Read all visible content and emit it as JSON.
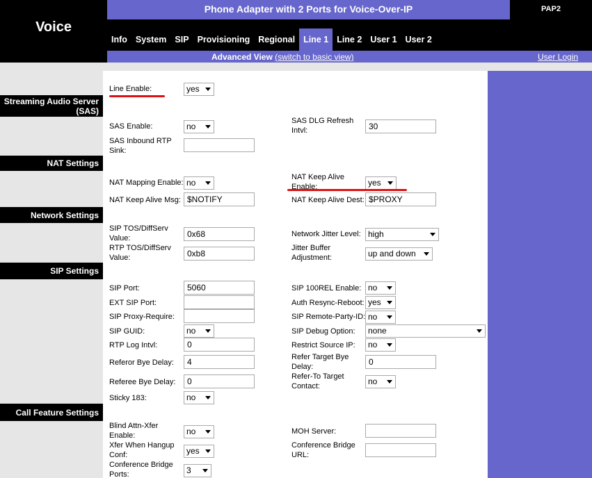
{
  "header": {
    "brand": "Voice",
    "title": "Phone Adapter with 2 Ports for Voice-Over-IP",
    "model": "PAP2"
  },
  "tabs": [
    {
      "label": "Info"
    },
    {
      "label": "System"
    },
    {
      "label": "SIP"
    },
    {
      "label": "Provisioning"
    },
    {
      "label": "Regional"
    },
    {
      "label": "Line 1",
      "active": true
    },
    {
      "label": "Line 2"
    },
    {
      "label": "User 1"
    },
    {
      "label": "User 2"
    }
  ],
  "subbar": {
    "view": "Advanced View",
    "switch_link": "(switch to basic view)",
    "login": "User Login"
  },
  "sections": {
    "sas": "Streaming Audio Server (SAS)",
    "nat": "NAT Settings",
    "network": "Network Settings",
    "sip": "SIP Settings",
    "call_feature": "Call Feature Settings"
  },
  "fields": {
    "line_enable": {
      "label": "Line Enable:",
      "value": "yes"
    },
    "sas_enable": {
      "label": "SAS Enable:",
      "value": "no"
    },
    "sas_dlg_refresh": {
      "label": "SAS DLG Refresh Intvl:",
      "value": "30"
    },
    "sas_inbound_rtp": {
      "label": "SAS Inbound RTP Sink:",
      "value": ""
    },
    "nat_mapping": {
      "label": "NAT Mapping Enable:",
      "value": "no"
    },
    "nat_keep_alive_enable": {
      "label": "NAT Keep Alive Enable:",
      "value": "yes"
    },
    "nat_keep_alive_msg": {
      "label": "NAT Keep Alive Msg:",
      "value": "$NOTIFY"
    },
    "nat_keep_alive_dest": {
      "label": "NAT Keep Alive Dest:",
      "value": "$PROXY"
    },
    "sip_tos": {
      "label": "SIP TOS/DiffServ Value:",
      "value": "0x68"
    },
    "network_jitter": {
      "label": "Network Jitter Level:",
      "value": "high"
    },
    "rtp_tos": {
      "label": "RTP TOS/DiffServ Value:",
      "value": "0xb8"
    },
    "jitter_buffer": {
      "label": "Jitter Buffer Adjustment:",
      "value": "up and down"
    },
    "sip_port": {
      "label": "SIP Port:",
      "value": "5060"
    },
    "sip_100rel": {
      "label": "SIP 100REL Enable:",
      "value": "no"
    },
    "ext_sip_port": {
      "label": "EXT SIP Port:",
      "value": ""
    },
    "auth_resync": {
      "label": "Auth Resync-Reboot:",
      "value": "yes"
    },
    "sip_proxy_require": {
      "label": "SIP Proxy-Require:",
      "value": ""
    },
    "sip_remote_party_id": {
      "label": "SIP Remote-Party-ID:",
      "value": "no"
    },
    "sip_guid": {
      "label": "SIP GUID:",
      "value": "no"
    },
    "sip_debug": {
      "label": "SIP Debug Option:",
      "value": "none"
    },
    "rtp_log": {
      "label": "RTP Log Intvl:",
      "value": "0"
    },
    "restrict_source_ip": {
      "label": "Restrict Source IP:",
      "value": "no"
    },
    "referor_bye": {
      "label": "Referor Bye Delay:",
      "value": "4"
    },
    "refer_target_bye": {
      "label": "Refer Target Bye Delay:",
      "value": "0"
    },
    "referee_bye": {
      "label": "Referee Bye Delay:",
      "value": "0"
    },
    "refer_to_target": {
      "label": "Refer-To Target Contact:",
      "value": "no"
    },
    "sticky_183": {
      "label": "Sticky 183:",
      "value": "no"
    },
    "blind_attn_xfer": {
      "label": "Blind Attn-Xfer Enable:",
      "value": "no"
    },
    "moh_server": {
      "label": "MOH Server:",
      "value": ""
    },
    "xfer_hangup": {
      "label": "Xfer When Hangup Conf:",
      "value": "yes"
    },
    "conf_bridge_url": {
      "label": "Conference Bridge URL:",
      "value": ""
    },
    "conf_bridge_ports": {
      "label": "Conference Bridge Ports:",
      "value": "3"
    }
  },
  "colors": {
    "accent": "#6666cc",
    "header": "#000000",
    "highlight": "#dd1111"
  }
}
